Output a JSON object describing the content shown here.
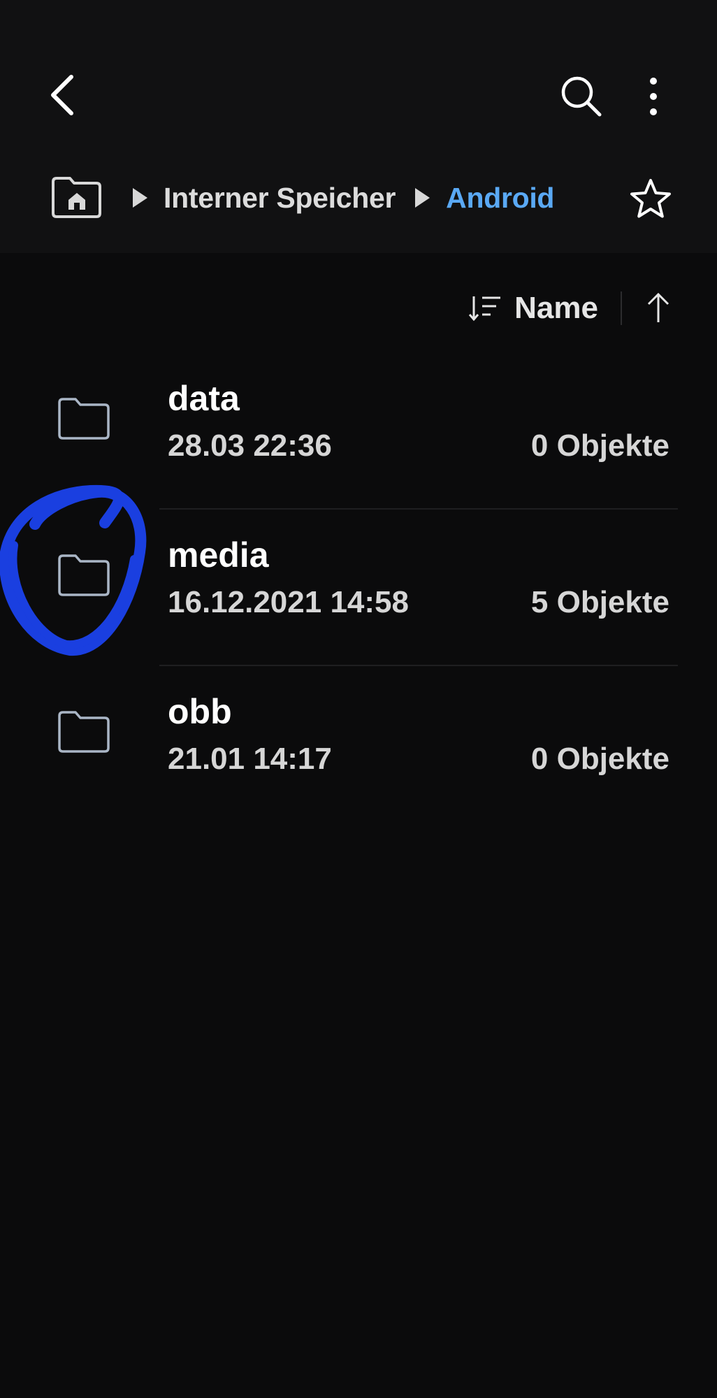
{
  "header": {
    "back_icon": "chevron-left-icon",
    "search_icon": "search-icon",
    "more_icon": "more-vert-icon"
  },
  "breadcrumb": {
    "home_icon": "home-icon",
    "items": [
      {
        "label": "Interner Speicher"
      },
      {
        "label": "Android"
      }
    ],
    "favorite_icon": "star-icon"
  },
  "sort": {
    "label": "Name",
    "sort_icon": "sort-icon",
    "direction_icon": "arrow-up-icon"
  },
  "files": [
    {
      "name": "data",
      "date": "28.03 22:36",
      "count": "0 Objekte"
    },
    {
      "name": "media",
      "date": "16.12.2021 14:58",
      "count": "5 Objekte"
    },
    {
      "name": "obb",
      "date": "21.01 14:17",
      "count": "0 Objekte"
    }
  ],
  "colors": {
    "background": "#0b0b0c",
    "header_bg": "#111112",
    "accent": "#5aa9f5",
    "annotation": "#1a3fe0"
  }
}
